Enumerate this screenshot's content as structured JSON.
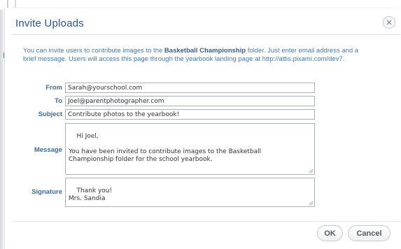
{
  "dialog": {
    "title": "Invite Uploads",
    "close_icon": "close-icon",
    "intro": {
      "part1": "You can invite users to contribute images to the ",
      "folder": "Basketball Championship",
      "part2": " folder. Just enter email address and a brief message. Users will access this page through the yearbook landing page at http://attis.pixami.com/dev7."
    },
    "form": {
      "from": {
        "label": "From",
        "value": "Sarah@yourschool.com"
      },
      "to": {
        "label": "To",
        "value": "Joel@parentphotographer.com"
      },
      "subject": {
        "label": "Subject",
        "value": "Contribute photos to the yearbook!"
      },
      "message": {
        "label": "Message",
        "value": "Hi Joel,\n\nYou have been invited to contribute images to the Basketball\nChampionship folder for the school yearbook."
      },
      "signature": {
        "label": "Signature",
        "value": "Thank you!\nMrs. Sandia"
      }
    },
    "buttons": {
      "ok": "OK",
      "cancel": "Cancel"
    }
  }
}
